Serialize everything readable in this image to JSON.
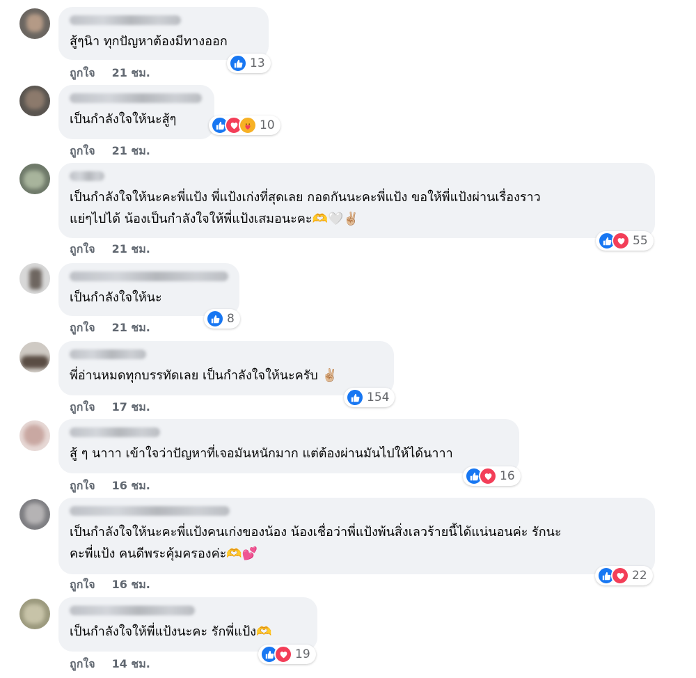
{
  "ui": {
    "like_label": "ถูกใจ"
  },
  "colors": {
    "like": "#1877f2",
    "love": "#f33e58",
    "care": "#f7b125",
    "bubble": "#f0f2f5",
    "meta": "#606770"
  },
  "comments": [
    {
      "text": "สู้ๆนิา ทุกปัญหาต้องมีทางออก",
      "time": "21 ชม.",
      "reactions": [
        "like"
      ],
      "count": "13"
    },
    {
      "text": "เป็นกำลังใจให้นะสู้ๆ",
      "time": "21 ชม.",
      "reactions": [
        "like",
        "love",
        "care"
      ],
      "count": "10"
    },
    {
      "text": "เป็นกำลังใจให้นะคะพี่แป้ง พี่แป้งเก่งที่สุดเลย กอดกันนะคะพี่แป้ง ขอให้พี่แป้งผ่านเรื่องราว\nแย่ๆไปได้ น้องเป็นกำลังใจให้พี่แป้งเสมอนะคะ🫶🤍✌🏼",
      "time": "21 ชม.",
      "reactions": [
        "like",
        "love"
      ],
      "count": "55"
    },
    {
      "text": "เป็นกำลังใจให้นะ",
      "time": "21 ชม.",
      "reactions": [
        "like"
      ],
      "count": "8"
    },
    {
      "text": "พี่อ่านหมดทุกบรรทัดเลย เป็นกำลังใจให้นะครับ ✌🏼",
      "time": "17 ชม.",
      "reactions": [
        "like"
      ],
      "count": "154"
    },
    {
      "text": "สู้ ๆ นาาา เข้าใจว่าปัญหาที่เจอมันหนักมาก แต่ต้องผ่านมันไปให้ได้นาาา",
      "time": "16 ชม.",
      "reactions": [
        "like",
        "love"
      ],
      "count": "16"
    },
    {
      "text": "เป็นกำลังใจให้นะคะพี่แป้งคนเก่งของน้อง น้องเชื่อว่าพี่แป้งพ้นสิ่งเลวร้ายนี้ได้แน่นอนค่ะ รักนะ\nคะพี่แป้ง คนดีพระคุ้มครองค่ะ🫶💕",
      "time": "16 ชม.",
      "reactions": [
        "like",
        "love"
      ],
      "count": "22"
    },
    {
      "text": "เป็นกำลังใจให้พี่แป้งนะคะ รักพี่แป้ง🫶",
      "time": "14 ชม.",
      "reactions": [
        "like",
        "love"
      ],
      "count": "19"
    }
  ]
}
